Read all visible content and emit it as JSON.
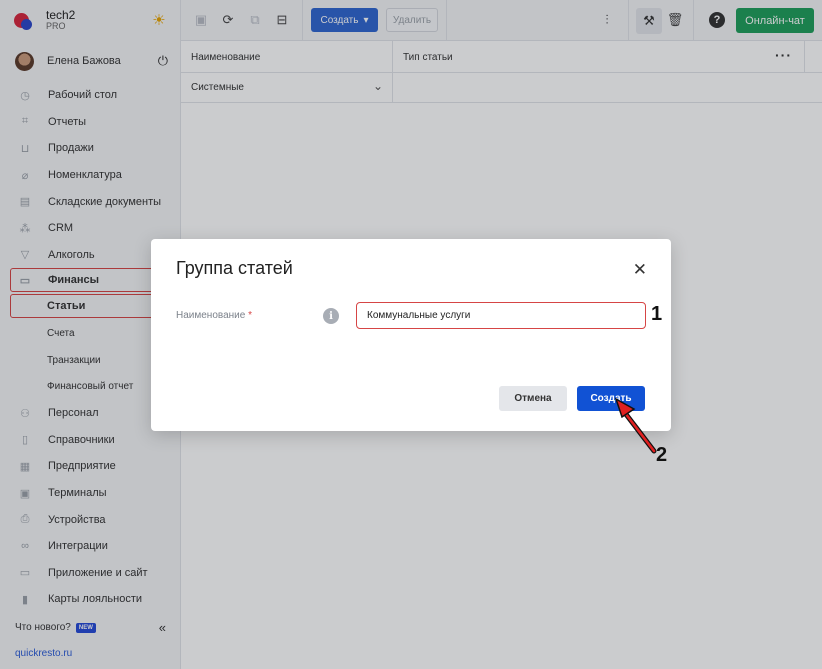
{
  "brand": {
    "name": "tech2",
    "plan": "PRO"
  },
  "user": {
    "name": "Елена Бажова"
  },
  "menu": [
    {
      "label": "Рабочий стол",
      "icon": "dashboard-icon"
    },
    {
      "label": "Отчеты",
      "icon": "reports-icon"
    },
    {
      "label": "Продажи",
      "icon": "basket-icon"
    },
    {
      "label": "Номенклатура",
      "icon": "tag-icon"
    },
    {
      "label": "Складские документы",
      "icon": "warehouse-icon"
    },
    {
      "label": "CRM",
      "icon": "crm-icon"
    },
    {
      "label": "Алкоголь",
      "icon": "glass-icon"
    },
    {
      "label": "Финансы",
      "icon": "wallet-icon"
    },
    {
      "label": "Статьи"
    },
    {
      "label": "Счета"
    },
    {
      "label": "Транзакции"
    },
    {
      "label": "Финансовый отчет"
    },
    {
      "label": "Персонал",
      "icon": "people-icon"
    },
    {
      "label": "Справочники",
      "icon": "book-icon"
    },
    {
      "label": "Предприятие",
      "icon": "building-icon"
    },
    {
      "label": "Терминалы",
      "icon": "terminal-icon"
    },
    {
      "label": "Устройства",
      "icon": "printer-icon"
    },
    {
      "label": "Интеграции",
      "icon": "link-icon"
    },
    {
      "label": "Приложение и сайт",
      "icon": "app-icon"
    },
    {
      "label": "Карты лояльности",
      "icon": "card-icon"
    }
  ],
  "footer": {
    "whats_new": "Что нового?",
    "new_badge": "NEW",
    "site": "quickresto.ru"
  },
  "toolbar": {
    "create": "Создать",
    "delete": "Удалить",
    "chat": "Онлайн-чат"
  },
  "table": {
    "columns": [
      "Наименование",
      "Тип статьи"
    ],
    "rows": [
      {
        "name": "Системные"
      }
    ]
  },
  "modal": {
    "title": "Группа статей",
    "field_label": "Наименование",
    "required_mark": "*",
    "input_value": "Коммунальные услуги",
    "cancel": "Отмена",
    "create": "Создать"
  },
  "annotations": {
    "step1": "1",
    "step2": "2"
  },
  "colors": {
    "accent": "#1152d4",
    "chat": "#1e9e5a",
    "highlight": "#d64545"
  }
}
